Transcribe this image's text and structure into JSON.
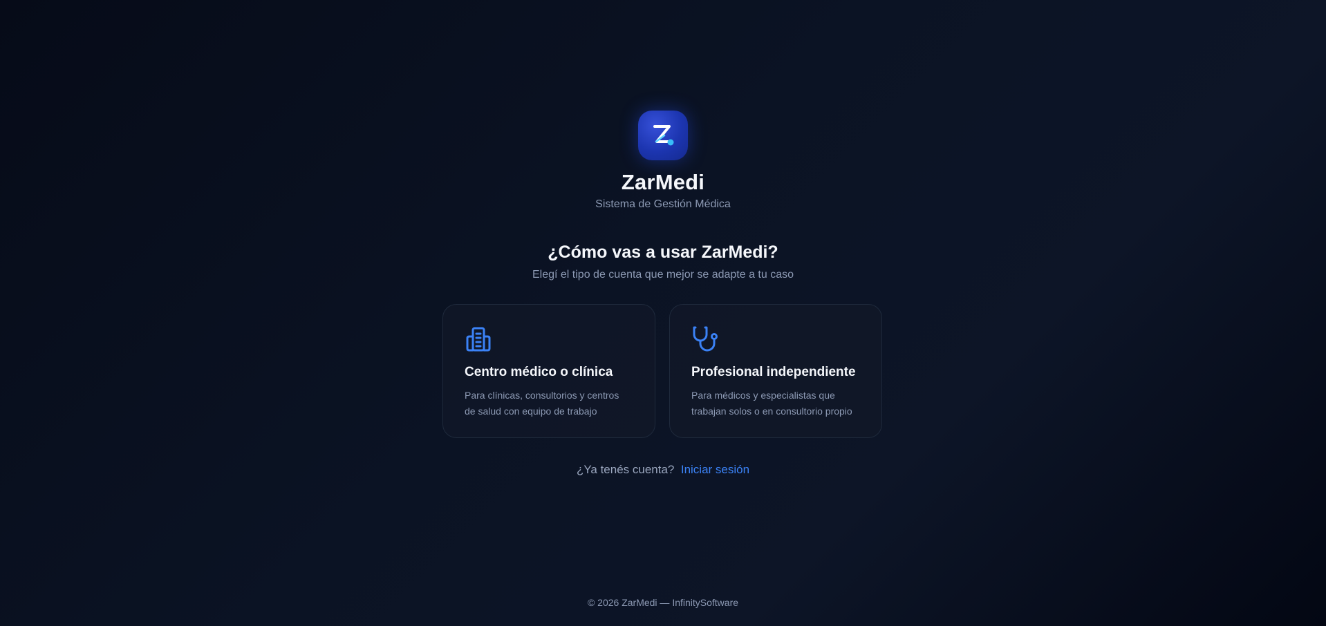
{
  "brand": {
    "logo_letter": "Z",
    "name": "ZarMedi",
    "tagline": "Sistema de Gestión Médica"
  },
  "onboarding": {
    "question": "¿Cómo vas a usar ZarMedi?",
    "subtitle": "Elegí el tipo de cuenta que mejor se adapte a tu caso"
  },
  "account_types": [
    {
      "icon": "building-icon",
      "title": "Centro médico o clínica",
      "description_line1": "Para clínicas, consultorios y centros",
      "description_line2": "de salud con equipo de trabajo"
    },
    {
      "icon": "stethoscope-icon",
      "title": "Profesional independiente",
      "description_line1": "Para médicos y especialistas que",
      "description_line2": "trabajan solos o en consultorio propio"
    }
  ],
  "login": {
    "prompt": "¿Ya tenés cuenta?",
    "link_label": "Iniciar sesión"
  },
  "footer": {
    "text": "© 2026 ZarMedi — InfinitySoftware"
  },
  "colors": {
    "accent": "#3b82f6",
    "logo_bg": "#1c35b0",
    "background": "#0b1324",
    "muted_text": "#8d9ab4"
  }
}
